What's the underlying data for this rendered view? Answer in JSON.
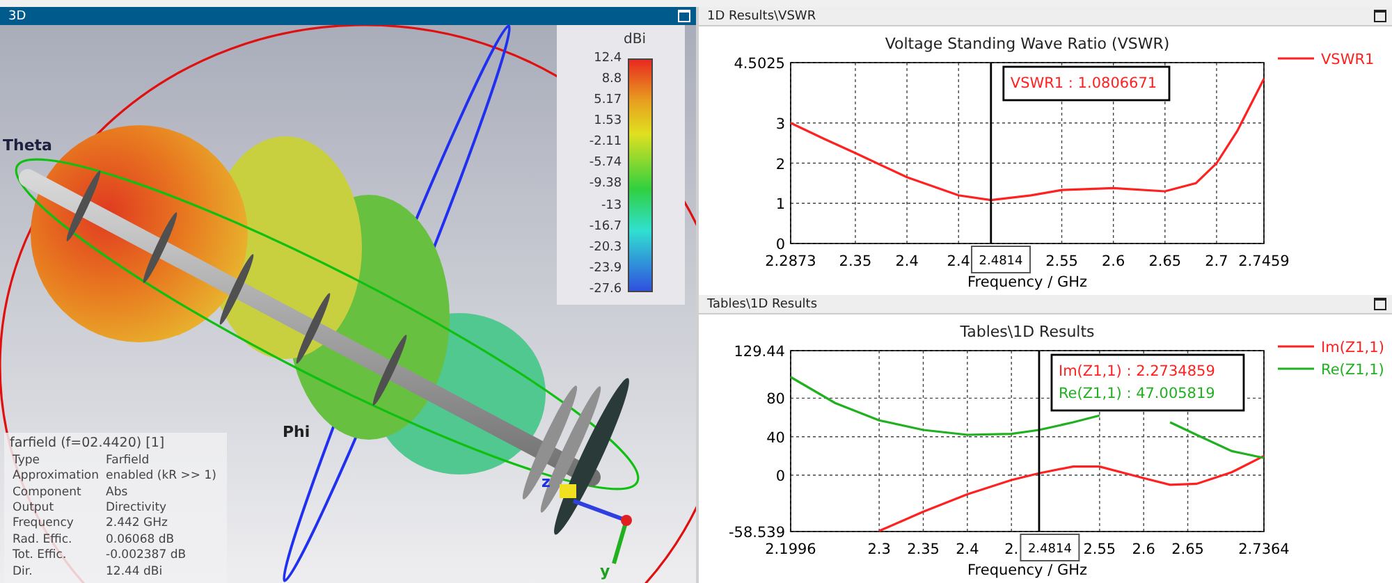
{
  "panel_3d": {
    "title": "3D",
    "axis_labels": [
      {
        "kind": "theta",
        "text": "Theta"
      },
      {
        "kind": "phi",
        "text": "Phi"
      },
      {
        "kind": "z",
        "text": "z"
      },
      {
        "kind": "y",
        "text": "y"
      }
    ],
    "colorbar": {
      "unit": "dBi",
      "ticks": [
        "12.4",
        "8.8",
        "5.17",
        "1.53",
        "-2.11",
        "-5.74",
        "-9.38",
        "-13",
        "-16.7",
        "-20.3",
        "-23.9",
        "-27.6"
      ]
    },
    "info": {
      "title": "farfield (f=02.4420) [1]",
      "rows": [
        {
          "label": "Type",
          "value": "Farfield"
        },
        {
          "label": "Approximation",
          "value": "enabled (kR >> 1)"
        },
        {
          "label": "Component",
          "value": "Abs"
        },
        {
          "label": "Output",
          "value": "Directivity"
        },
        {
          "label": "Frequency",
          "value": "2.442 GHz"
        },
        {
          "label": "Rad. Effic.",
          "value": "0.06068 dB"
        },
        {
          "label": "Tot. Effic.",
          "value": "-0.002387 dB"
        },
        {
          "label": "Dir.",
          "value": "12.44 dBi"
        }
      ]
    }
  },
  "panels": [
    {
      "title": "1D Results\\VSWR",
      "chart_data": {
        "type": "line",
        "title": "Voltage Standing Wave Ratio (VSWR)",
        "xlabel": "Frequency / GHz",
        "x": [
          2.2873,
          2.32,
          2.35,
          2.4,
          2.45,
          2.4814,
          2.52,
          2.55,
          2.6,
          2.65,
          2.68,
          2.7,
          2.72,
          2.7459
        ],
        "series": [
          {
            "name": "VSWR1",
            "color": "#ff2020",
            "values": [
              3.0,
              2.6,
              2.25,
              1.65,
              1.2,
              1.08,
              1.2,
              1.33,
              1.38,
              1.3,
              1.5,
              2.0,
              2.8,
              4.1
            ]
          }
        ],
        "xlim": [
          2.2873,
          2.7459
        ],
        "ylim": [
          0,
          4.5025
        ],
        "xticks": [
          2.2873,
          2.35,
          2.4,
          {
            "value": 2.45,
            "label": "2.4"
          },
          2.55,
          2.6,
          2.65,
          2.7,
          2.7459
        ],
        "yticks": [
          0,
          1,
          2,
          3,
          4.5025
        ],
        "grid": true,
        "legend": true,
        "ref_lines": [
          {
            "axis": "x",
            "value": 2.4814,
            "label": "2.4814"
          }
        ],
        "annotations": [
          {
            "text": "VSWR1 : 1.0806671"
          }
        ]
      }
    },
    {
      "title": "Tables\\1D Results",
      "chart_data": {
        "type": "line",
        "title": "Tables\\1D Results",
        "xlabel": "Frequency / GHz",
        "x": [
          2.1996,
          2.25,
          2.3,
          2.35,
          2.4,
          2.45,
          2.4814,
          2.52,
          2.55,
          2.6,
          2.63,
          2.66,
          2.7,
          2.7364
        ],
        "series": [
          {
            "name": "Im(Z1,1)",
            "color": "#ff2020",
            "values": [
              null,
              null,
              -58,
              -38,
              -20,
              -5,
              2,
              9,
              9,
              -3,
              -10,
              -9,
              3,
              20
            ]
          },
          {
            "name": "Re(Z1,1)",
            "color": "#20b020",
            "values": [
              102,
              75,
              57,
              47,
              42,
              43,
              47,
              55,
              62,
              null,
              55,
              42,
              25,
              18
            ]
          }
        ],
        "xlim": [
          2.1996,
          2.7364
        ],
        "ylim": [
          -58.539,
          129.44
        ],
        "xticks": [
          2.1996,
          2.3,
          2.35,
          2.4,
          {
            "value": 2.45,
            "label": "2."
          },
          2.55,
          2.6,
          2.65,
          2.7364
        ],
        "yticks": [
          -58.539,
          0,
          40,
          80,
          129.44
        ],
        "grid": true,
        "legend": true,
        "ref_lines": [
          {
            "axis": "x",
            "value": 2.4814,
            "label": "2.4814"
          }
        ],
        "annotations": [
          {
            "text": "Im(Z1,1) : 2.2734859"
          },
          {
            "text": "Re(Z1,1) : 47.005819"
          }
        ]
      }
    }
  ]
}
